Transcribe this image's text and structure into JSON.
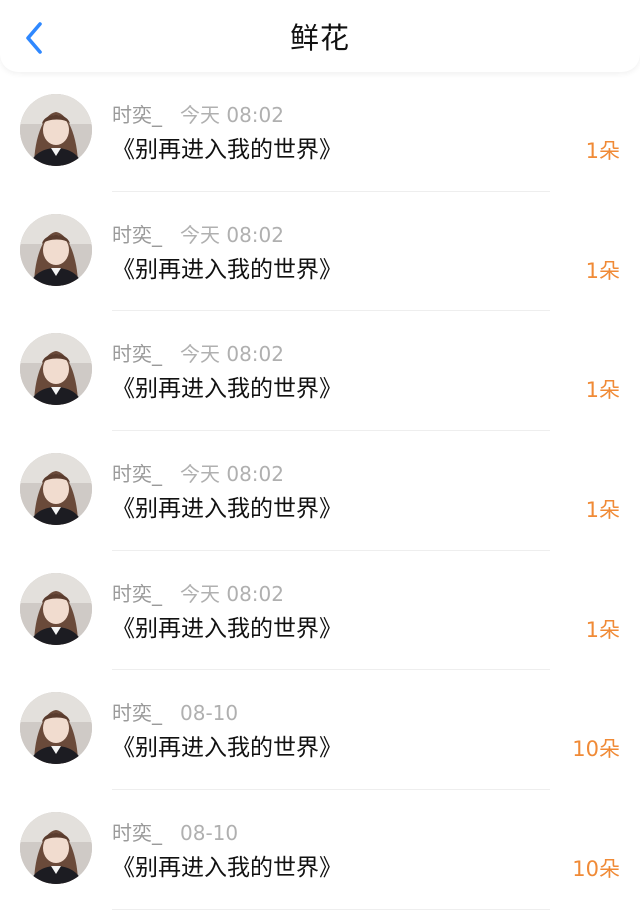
{
  "header": {
    "title": "鲜花",
    "back_icon": "chevron-left-icon",
    "accent_color": "#2f88ff"
  },
  "flowers": [
    {
      "user": "时奕_",
      "time": "今天 08:02",
      "work": "《别再进入我的世界》",
      "count": "1朵"
    },
    {
      "user": "时奕_",
      "time": "今天 08:02",
      "work": "《别再进入我的世界》",
      "count": "1朵"
    },
    {
      "user": "时奕_",
      "time": "今天 08:02",
      "work": "《别再进入我的世界》",
      "count": "1朵"
    },
    {
      "user": "时奕_",
      "time": "今天 08:02",
      "work": "《别再进入我的世界》",
      "count": "1朵"
    },
    {
      "user": "时奕_",
      "time": "今天 08:02",
      "work": "《别再进入我的世界》",
      "count": "1朵"
    },
    {
      "user": "时奕_",
      "time": "08-10",
      "work": "《别再进入我的世界》",
      "count": "10朵"
    },
    {
      "user": "时奕_",
      "time": "08-10",
      "work": "《别再进入我的世界》",
      "count": "10朵"
    }
  ],
  "colors": {
    "count_color": "#f08a36",
    "meta_color": "#9a9a9a",
    "text_color": "#111111"
  }
}
